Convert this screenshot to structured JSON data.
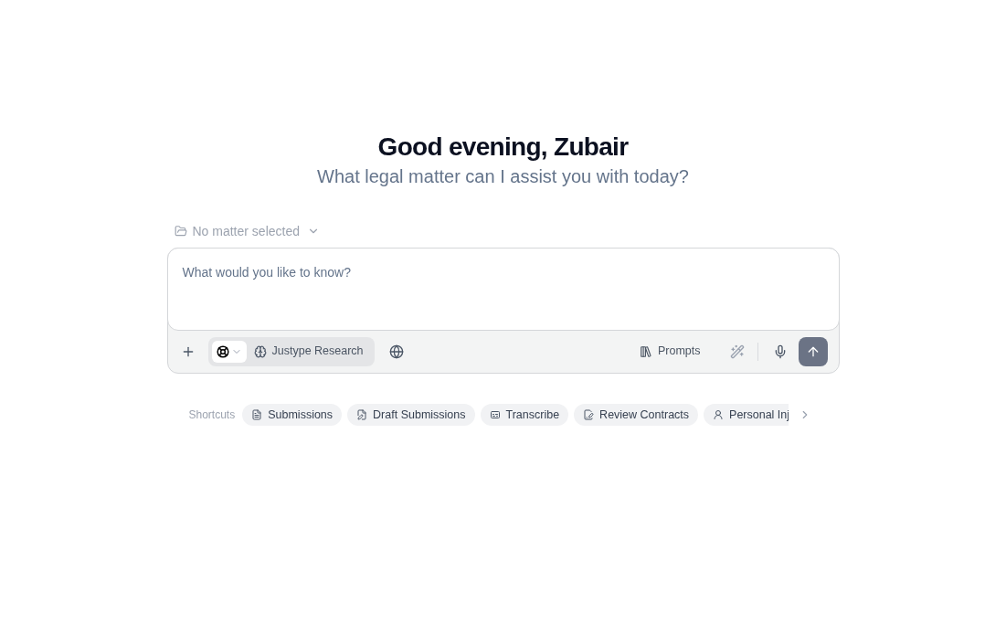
{
  "greeting": {
    "title": "Good evening, Zubair",
    "subtitle": "What legal matter can I assist you with today?"
  },
  "matter_selector": {
    "label": "No matter selected"
  },
  "composer": {
    "placeholder": "What would you like to know?",
    "model": {
      "label": "Justype Research"
    },
    "prompts_button": {
      "label": "Prompts"
    }
  },
  "shortcuts": {
    "label": "Shortcuts",
    "items": [
      {
        "label": "Submissions",
        "kind": "document"
      },
      {
        "label": "Draft Submissions",
        "kind": "draft"
      },
      {
        "label": "Transcribe",
        "kind": "transcribe"
      },
      {
        "label": "Review Contracts",
        "kind": "review"
      },
      {
        "label": "Personal Inj",
        "kind": "person"
      }
    ]
  }
}
